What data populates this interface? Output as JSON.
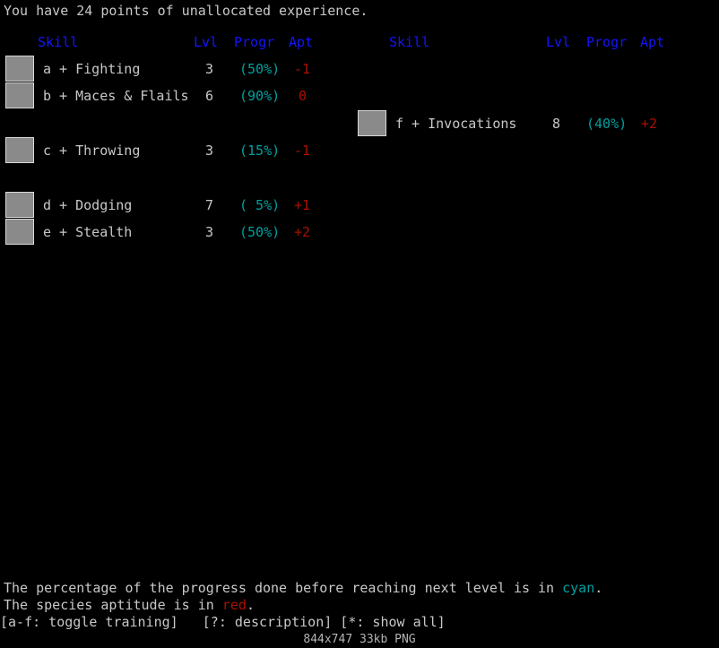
{
  "message": "You have 24 points of unallocated experience.",
  "columns": {
    "skill": "Skill",
    "lvl": "Lvl",
    "progr": "Progr",
    "apt": "Apt"
  },
  "colors": {
    "header_blue": "#1414ff",
    "progress_cyan": "#00a0a0",
    "aptitude_red": "#aa1100",
    "text_white": "#c8c8c8",
    "background": "#000000"
  },
  "left_column": {
    "skills": [
      {
        "key": "a",
        "toggle": "+",
        "name": "Fighting",
        "label": "a + Fighting",
        "lvl": "3",
        "progr": "(50%)",
        "apt": "-1",
        "icon": "fighting-icon"
      },
      {
        "key": "b",
        "toggle": "+",
        "name": "Maces & Flails",
        "label": "b + Maces & Flails",
        "lvl": "6",
        "progr": "(90%)",
        "apt": "0",
        "icon": "maces-flails-icon"
      },
      {
        "key": "c",
        "toggle": "+",
        "name": "Throwing",
        "label": "c + Throwing",
        "lvl": "3",
        "progr": "(15%)",
        "apt": "-1",
        "icon": "throwing-icon"
      },
      {
        "key": "d",
        "toggle": "+",
        "name": "Dodging",
        "label": "d + Dodging",
        "lvl": "7",
        "progr": "( 5%)",
        "apt": "+1",
        "icon": "dodging-icon"
      },
      {
        "key": "e",
        "toggle": "+",
        "name": "Stealth",
        "label": "e + Stealth",
        "lvl": "3",
        "progr": "(50%)",
        "apt": "+2",
        "icon": "stealth-icon"
      }
    ]
  },
  "right_column": {
    "skills": [
      {
        "key": "f",
        "toggle": "+",
        "name": "Invocations",
        "label": "f + Invocations",
        "lvl": "8",
        "progr": "(40%)",
        "apt": "+2",
        "icon": "invocations-icon"
      }
    ]
  },
  "footer": {
    "line1_part1": "The percentage of the progress done before reaching next level is in ",
    "line1_cyan": "cyan",
    "line1_part2": ".",
    "line2_part1": "The species aptitude is in ",
    "line2_red": "red",
    "line2_part2": ".",
    "keys": "[a-f: toggle training]   [?: description] [*: show all]"
  },
  "status_bar": "844x747 33kb PNG"
}
